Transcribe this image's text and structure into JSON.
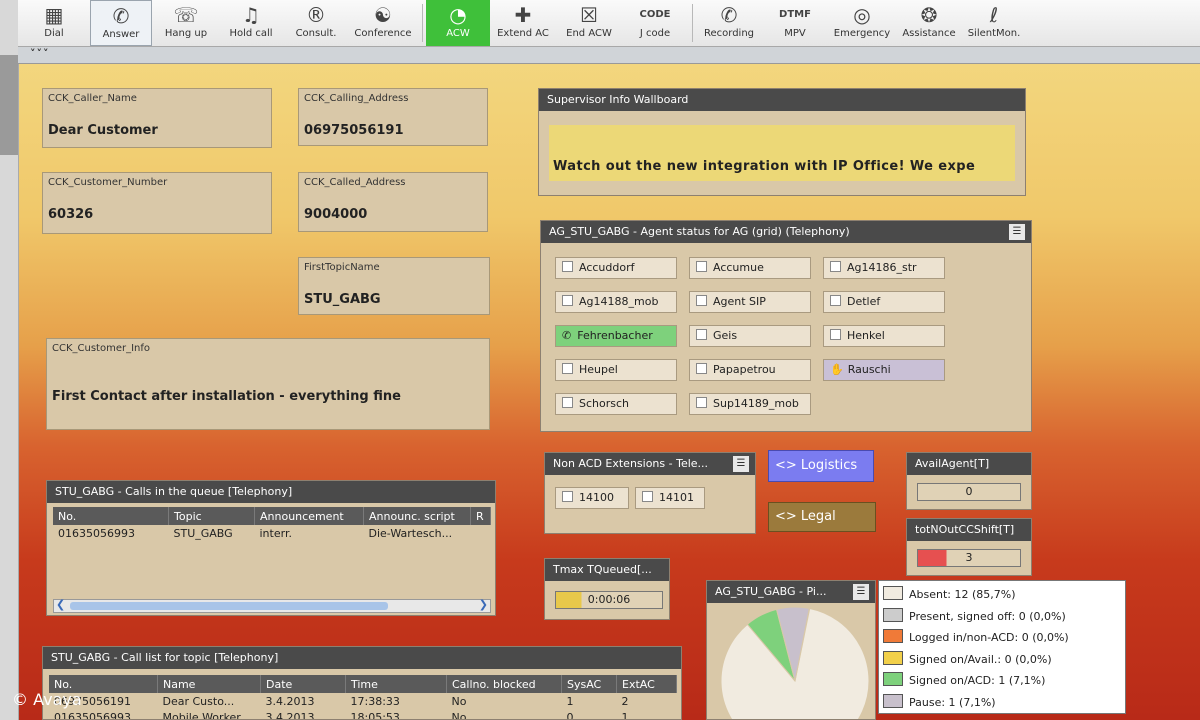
{
  "toolbar": {
    "buttons": [
      {
        "label": "Dial",
        "icon": "dialpad-icon"
      },
      {
        "label": "Answer",
        "icon": "phone-answer-icon"
      },
      {
        "label": "Hang up",
        "icon": "hangup-icon"
      },
      {
        "label": "Hold call",
        "icon": "hold-music-icon"
      },
      {
        "label": "Consult.",
        "icon": "consult-icon"
      },
      {
        "label": "Conference",
        "icon": "conference-icon"
      },
      {
        "label": "ACW",
        "icon": "acw-pie-icon"
      },
      {
        "label": "Extend AC",
        "icon": "extend-ac-icon"
      },
      {
        "label": "End ACW",
        "icon": "end-acw-icon"
      },
      {
        "label": "J code",
        "icon": "code-icon",
        "icon_text": "CODE"
      },
      {
        "label": "Recording",
        "icon": "recording-icon"
      },
      {
        "label": "MPV",
        "icon": "dtmf-icon",
        "icon_text": "DTMF"
      },
      {
        "label": "Emergency",
        "icon": "lifebuoy-icon"
      },
      {
        "label": "Assistance",
        "icon": "assistance-icon"
      },
      {
        "label": "SilentMon.",
        "icon": "ear-icon"
      }
    ],
    "active_color": "#3fc03a",
    "subbar_text": "˅˅˅"
  },
  "fields": {
    "caller_name": {
      "label": "CCK_Caller_Name",
      "value": "Dear Customer"
    },
    "calling_address": {
      "label": "CCK_Calling_Address",
      "value": "06975056191"
    },
    "customer_number": {
      "label": "CCK_Customer_Number",
      "value": "60326"
    },
    "called_address": {
      "label": "CCK_Called_Address",
      "value": "9004000"
    },
    "first_topic": {
      "label": "FirstTopicName",
      "value": "STU_GABG"
    },
    "customer_info": {
      "label": "CCK_Customer_Info",
      "value": "First Contact after installation - everything fine"
    }
  },
  "wallboard": {
    "title": "Supervisor Info Wallboard",
    "message": "Watch out the new integration with IP Office! We expe"
  },
  "agent_grid": {
    "title": "AG_STU_GABG - Agent status for AG (grid) (Telephony)",
    "agents": [
      {
        "name": "Accuddorf",
        "state": "absent"
      },
      {
        "name": "Accumue",
        "state": "absent"
      },
      {
        "name": "Ag14186_str",
        "state": "absent"
      },
      {
        "name": "Ag14188_mob",
        "state": "absent"
      },
      {
        "name": "Agent SIP",
        "state": "absent"
      },
      {
        "name": "Detlef",
        "state": "absent"
      },
      {
        "name": "Fehrenbacher",
        "state": "acd"
      },
      {
        "name": "Geis",
        "state": "absent"
      },
      {
        "name": "Henkel",
        "state": "absent"
      },
      {
        "name": "Heupel",
        "state": "absent"
      },
      {
        "name": "Papapetrou",
        "state": "absent"
      },
      {
        "name": "Rauschi",
        "state": "pause"
      },
      {
        "name": "Schorsch",
        "state": "absent"
      },
      {
        "name": "Sup14189_mob",
        "state": "absent"
      }
    ]
  },
  "non_acd": {
    "title": "Non ACD Extensions - Tele...",
    "extensions": [
      "14100",
      "14101"
    ]
  },
  "topics": {
    "logistics": "<> Logistics",
    "legal": "<> Legal",
    "logistics_color": "#7b7cf0",
    "legal_color": "#9b7a3c"
  },
  "avail_agent": {
    "title": "AvailAgent[T]",
    "value": "0"
  },
  "tot_out": {
    "title": "totNOutCCShift[T]",
    "value": "3"
  },
  "tmax": {
    "title": "Tmax TQueued[...",
    "value": "0:00:06"
  },
  "queue": {
    "title": "STU_GABG - Calls in the queue [Telephony]",
    "columns": [
      "No.",
      "Topic",
      "Announcement",
      "Announc. script",
      "R"
    ],
    "rows": [
      [
        "01635056993",
        "STU_GABG",
        "interr.",
        "Die-Wartesch...",
        ""
      ]
    ]
  },
  "call_list": {
    "title": "STU_GABG - Call list for topic [Telephony]",
    "columns": [
      "No.",
      "Name",
      "Date",
      "Time",
      "Callno. blocked",
      "SysAC",
      "ExtAC"
    ],
    "rows": [
      [
        "06975056191",
        "Dear Custo...",
        "3.4.2013",
        "17:38:33",
        "No",
        "1",
        "2"
      ],
      [
        "01635056993",
        "Mobile Worker",
        "3.4.2013",
        "18:05:53",
        "No",
        "0",
        "1"
      ]
    ]
  },
  "pie": {
    "title": "AG_STU_GABG - Pi...",
    "legend": [
      {
        "label": "Absent: 12 (85,7%)",
        "color": "#f1ebe0",
        "fraction": 0.857
      },
      {
        "label": "Present, signed off: 0 (0,0%)",
        "color": "#cccccc",
        "fraction": 0
      },
      {
        "label": "Logged in/non-ACD: 0 (0,0%)",
        "color": "#f07a38",
        "fraction": 0
      },
      {
        "label": "Signed on/Avail.: 0 (0,0%)",
        "color": "#f2d04a",
        "fraction": 0
      },
      {
        "label": "Signed on/ACD: 1 (7,1%)",
        "color": "#7ed17c",
        "fraction": 0.071
      },
      {
        "label": "Pause: 1 (7,1%)",
        "color": "#c8c0cc",
        "fraction": 0.071
      }
    ]
  },
  "copyright": "© Avaya"
}
